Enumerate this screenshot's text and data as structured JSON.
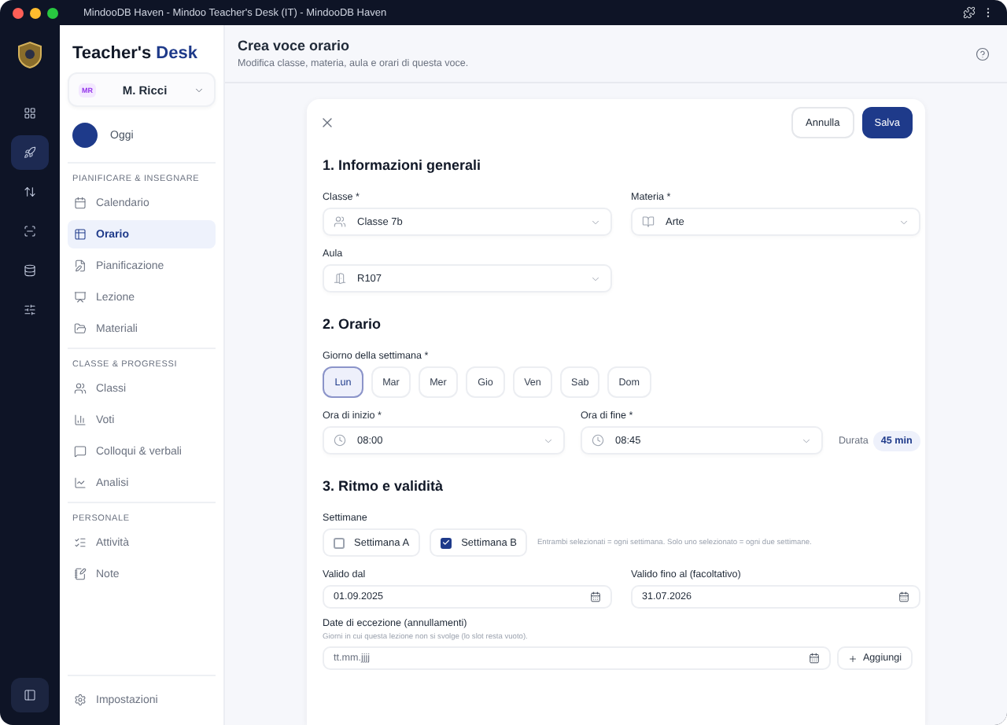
{
  "window": {
    "title": "MindooDB Haven - Mindoo Teacher's Desk (IT) - MindooDB Haven"
  },
  "rail": {
    "items": [
      {
        "selected": false
      },
      {
        "selected": true
      },
      {
        "selected": false
      },
      {
        "selected": false
      },
      {
        "selected": false
      },
      {
        "selected": false
      }
    ]
  },
  "sidebar": {
    "brand": {
      "part_1": "Teacher's",
      "part_2": "Desk"
    },
    "user": {
      "initials": "MR",
      "name": "M. Ricci"
    },
    "today": "Oggi",
    "sections": [
      {
        "title": "PIANIFICARE & INSEGNARE",
        "items": [
          {
            "label": "Calendario",
            "selected": false
          },
          {
            "label": "Orario",
            "selected": true
          },
          {
            "label": "Pianificazione",
            "selected": false
          },
          {
            "label": "Lezione",
            "selected": false
          },
          {
            "label": "Materiali",
            "selected": false
          }
        ]
      },
      {
        "title": "CLASSE & PROGRESSI",
        "items": [
          {
            "label": "Classi",
            "selected": false
          },
          {
            "label": "Voti",
            "selected": false
          },
          {
            "label": "Colloqui & verbali",
            "selected": false
          },
          {
            "label": "Analisi",
            "selected": false
          }
        ]
      },
      {
        "title": "PERSONALE",
        "items": [
          {
            "label": "Attività",
            "selected": false
          },
          {
            "label": "Note",
            "selected": false
          }
        ]
      }
    ],
    "settings": "Impostazioni"
  },
  "header": {
    "title": "Crea voce orario",
    "subtitle": "Modifica classe, materia, aula e orari di questa voce."
  },
  "form": {
    "buttons": {
      "cancel": "Annulla",
      "save": "Salva"
    },
    "section_1": {
      "title": "1. Informazioni generali",
      "class": {
        "label": "Classe *",
        "value": "Classe 7b"
      },
      "subject": {
        "label": "Materia *",
        "value": "Arte"
      },
      "room": {
        "label": "Aula",
        "value": "R107"
      }
    },
    "section_2": {
      "title": "2. Orario",
      "weekday_label": "Giorno della settimana *",
      "days": [
        {
          "label": "Lun",
          "selected": true
        },
        {
          "label": "Mar",
          "selected": false
        },
        {
          "label": "Mer",
          "selected": false
        },
        {
          "label": "Gio",
          "selected": false
        },
        {
          "label": "Ven",
          "selected": false
        },
        {
          "label": "Sab",
          "selected": false
        },
        {
          "label": "Dom",
          "selected": false
        }
      ],
      "start": {
        "label": "Ora di inizio *",
        "value": "08:00"
      },
      "end": {
        "label": "Ora di fine *",
        "value": "08:45"
      },
      "duration_label": "Durata",
      "duration": "45 min"
    },
    "section_3": {
      "title": "3. Ritmo e validità",
      "weeks_label": "Settimane",
      "weeks": [
        {
          "label": "Settimana A",
          "checked": false
        },
        {
          "label": "Settimana B",
          "checked": true
        }
      ],
      "weeks_hint": "Entrambi selezionati = ogni settimana. Solo uno selezionato = ogni due settimane.",
      "valid_from": {
        "label": "Valido dal",
        "value": "01.09.2025"
      },
      "valid_to": {
        "label": "Valido fino al (facoltativo)",
        "value": "31.07.2026"
      },
      "exceptions": {
        "label": "Date di eccezione (annullamenti)",
        "hint": "Giorni in cui questa lezione non si svolge (lo slot resta vuoto).",
        "placeholder": "tt.mm.jjjj",
        "add": "Aggiungi"
      }
    }
  }
}
